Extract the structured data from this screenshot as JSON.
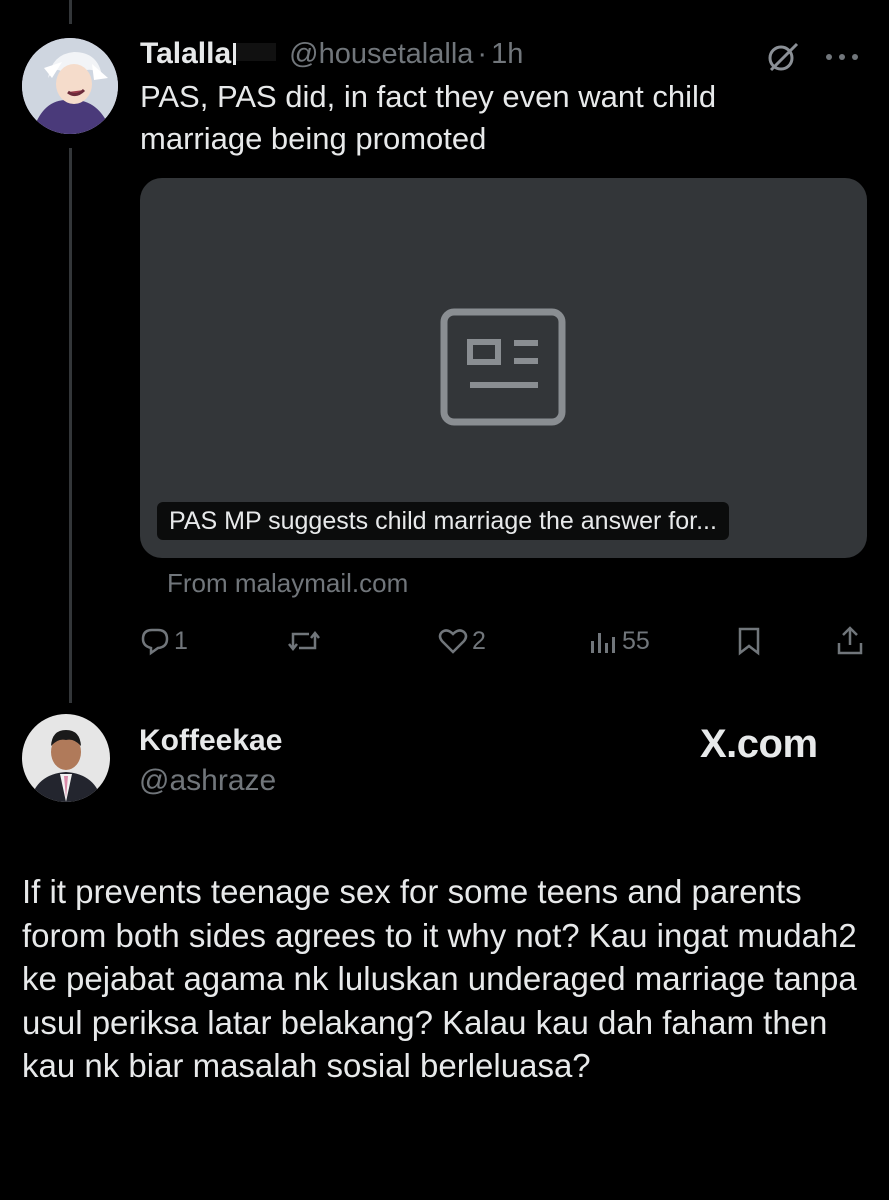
{
  "parent_tweet": {
    "display_name": "Talalla",
    "flag_icon": "black-flag-icon",
    "handle": "@housetalalla",
    "separator": "·",
    "time": "1h",
    "text_line1": "PAS, PAS did, in fact they even want child",
    "text_line2": "marriage being promoted",
    "link_card": {
      "title": "PAS MP suggests child marriage the answer for...",
      "source": "From malaymail.com",
      "placeholder_icon": "news-article-icon"
    },
    "actions": {
      "replies": "1",
      "reposts": "",
      "likes": "2",
      "views": "55"
    }
  },
  "reply_tweet": {
    "display_name": "Koffeekae",
    "handle": "@ashraze",
    "brand": "X.com",
    "text": "If it prevents teenage sex for some teens and parents forom both sides agrees to it why not? Kau ingat mudah2 ke pejabat agama nk luluskan underaged marriage tanpa usul periksa latar belakang? Kalau kau dah faham then kau nk biar masalah sosial berleluasa?"
  },
  "colors": {
    "background": "#000000",
    "text": "#e7e9ea",
    "muted": "#71767b",
    "card": "#333639"
  }
}
